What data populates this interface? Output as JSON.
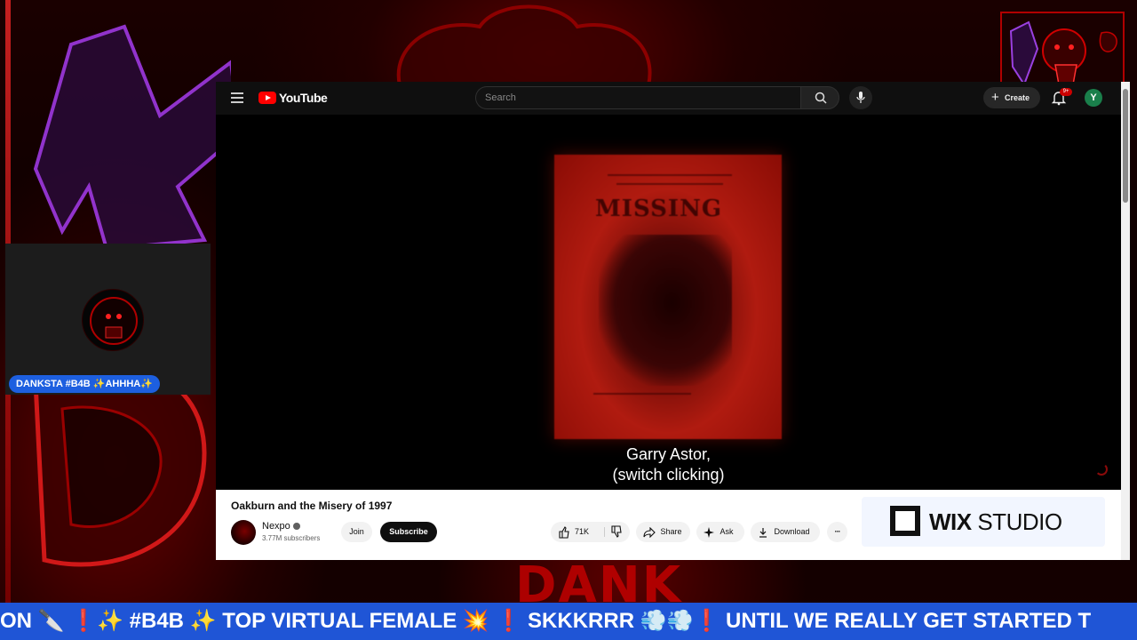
{
  "overlay": {
    "webcam_tag": "DANKSTA #B4B ✨AHHHA✨",
    "ticker_text": "ON 🔪 ❗✨ #B4B ✨ TOP VIRTUAL FEMALE 💥 ❗ SKKKRRR 💨💨❗ UNTIL WE REALLY GET STARTED T",
    "brand_word": "DANK"
  },
  "youtube": {
    "logo_text": "YouTube",
    "search_placeholder": "Search",
    "create_label": "Create",
    "notification_count": "9+",
    "account_initial": "Y",
    "caption_line1": "Garry Astor,",
    "caption_line2": "(switch clicking)",
    "poster_text": "MISSING",
    "video_title": "Oakburn and the Misery of 1997",
    "channel_name": "Nexpo",
    "subscriber_count": "3.77M subscribers",
    "join_label": "Join",
    "subscribe_label": "Subscribe",
    "like_count": "71K",
    "share_label": "Share",
    "ask_label": "Ask",
    "download_label": "Download",
    "ad": {
      "brand_bold": "WIX",
      "brand_thin": "STUDIO"
    }
  },
  "colors": {
    "ticker_bg": "#1f55d6",
    "youtube_red": "#ff0000",
    "stream_red": "#b00000"
  },
  "icons": [
    "hamburger-icon",
    "youtube-logo-icon",
    "search-icon",
    "mic-icon",
    "plus-icon",
    "bell-icon",
    "verified-icon",
    "thumbs-up-icon",
    "thumbs-down-icon",
    "share-icon",
    "ask-sparkle-icon",
    "download-icon",
    "more-icon"
  ]
}
